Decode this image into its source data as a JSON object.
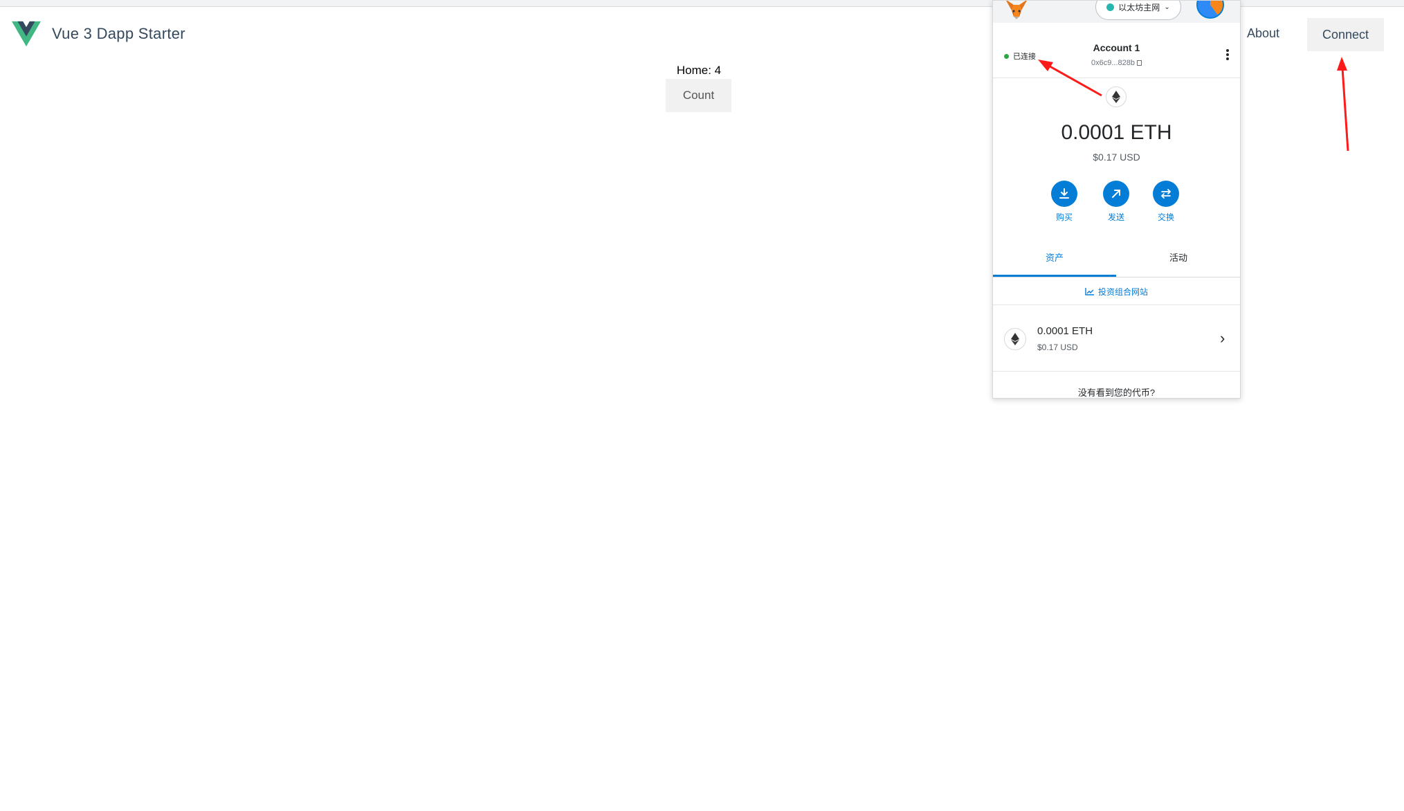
{
  "app": {
    "title": "Vue 3 Dapp Starter",
    "nav_about": "About",
    "connect_label": "Connect",
    "home_label": "Home: 4",
    "count_label": "Count"
  },
  "metamask": {
    "network": "以太坊主网",
    "connection_status": "已连接",
    "account_name": "Account 1",
    "account_address": "0x6c9...828b",
    "balance": "0.0001 ETH",
    "balance_usd": "$0.17 USD",
    "actions": [
      {
        "label": "购买",
        "icon": "download-icon"
      },
      {
        "label": "发送",
        "icon": "arrow-up-right-icon"
      },
      {
        "label": "交换",
        "icon": "swap-icon"
      }
    ],
    "tabs": [
      "资产",
      "活动"
    ],
    "active_tab": "资产",
    "portfolio_link": "投资组合网站",
    "assets": [
      {
        "amount": "0.0001 ETH",
        "usd": "$0.17 USD"
      }
    ],
    "not_seen_token": "没有看到您的代币?"
  },
  "colors": {
    "vue_green": "#41b883",
    "vue_dark": "#34495e",
    "metamask_blue": "#037dd6",
    "network_dot": "#29b6af",
    "connected_dot": "#28a745",
    "annotation_arrow": "#ff1a1a"
  }
}
